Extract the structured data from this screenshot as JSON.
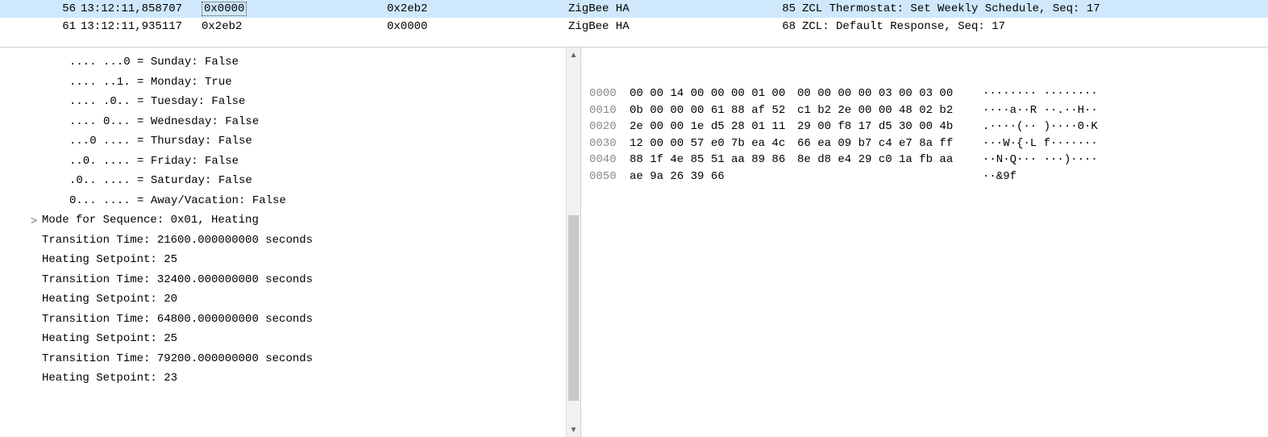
{
  "packet_list": [
    {
      "no": "56",
      "time": "13:12:11,858707",
      "src": "0x0000",
      "dst": "0x2eb2",
      "protocol": "ZigBee HA",
      "length": "85",
      "info": "ZCL Thermostat: Set Weekly Schedule, Seq: 17",
      "selected": true
    },
    {
      "no": "61",
      "time": "13:12:11,935117",
      "src": "0x2eb2",
      "dst": "0x0000",
      "protocol": "ZigBee HA",
      "length": "68",
      "info": "ZCL: Default Response, Seq: 17",
      "selected": false
    }
  ],
  "tree": [
    {
      "text": ".... ...0 = Sunday: False",
      "indent": 1,
      "expander": ""
    },
    {
      "text": ".... ..1. = Monday: True",
      "indent": 1,
      "expander": ""
    },
    {
      "text": ".... .0.. = Tuesday: False",
      "indent": 1,
      "expander": ""
    },
    {
      "text": ".... 0... = Wednesday: False",
      "indent": 1,
      "expander": ""
    },
    {
      "text": "...0 .... = Thursday: False",
      "indent": 1,
      "expander": ""
    },
    {
      "text": "..0. .... = Friday: False",
      "indent": 1,
      "expander": ""
    },
    {
      "text": ".0.. .... = Saturday: False",
      "indent": 1,
      "expander": ""
    },
    {
      "text": "0... .... = Away/Vacation: False",
      "indent": 1,
      "expander": ""
    },
    {
      "text": "Mode for Sequence: 0x01, Heating",
      "indent": 0,
      "expander": ">"
    },
    {
      "text": "Transition Time: 21600.000000000 seconds",
      "indent": 0,
      "expander": ""
    },
    {
      "text": "Heating Setpoint: 25",
      "indent": 0,
      "expander": ""
    },
    {
      "text": "Transition Time: 32400.000000000 seconds",
      "indent": 0,
      "expander": ""
    },
    {
      "text": "Heating Setpoint: 20",
      "indent": 0,
      "expander": ""
    },
    {
      "text": "Transition Time: 64800.000000000 seconds",
      "indent": 0,
      "expander": ""
    },
    {
      "text": "Heating Setpoint: 25",
      "indent": 0,
      "expander": ""
    },
    {
      "text": "Transition Time: 79200.000000000 seconds",
      "indent": 0,
      "expander": ""
    },
    {
      "text": "Heating Setpoint: 23",
      "indent": 0,
      "expander": ""
    }
  ],
  "hex": [
    {
      "offset": "0000",
      "b1": "00 00 14 00 00 00 01 00",
      "b2": "00 00 00 00 03 00 03 00",
      "ascii": "········ ········"
    },
    {
      "offset": "0010",
      "b1": "0b 00 00 00 61 88 af 52",
      "b2": "c1 b2 2e 00 00 48 02 b2",
      "ascii": "····a··R ··.··H··"
    },
    {
      "offset": "0020",
      "b1": "2e 00 00 1e d5 28 01 11",
      "b2": "29 00 f8 17 d5 30 00 4b",
      "ascii": ".····(·· )····0·K"
    },
    {
      "offset": "0030",
      "b1": "12 00 00 57 e0 7b ea 4c",
      "b2": "66 ea 09 b7 c4 e7 8a ff",
      "ascii": "···W·{·L f·······"
    },
    {
      "offset": "0040",
      "b1": "88 1f 4e 85 51 aa 89 86",
      "b2": "8e d8 e4 29 c0 1a fb aa",
      "ascii": "··N·Q··· ···)····"
    },
    {
      "offset": "0050",
      "b1": "ae 9a 26 39 66",
      "b2": "",
      "ascii": "··&9f"
    }
  ]
}
